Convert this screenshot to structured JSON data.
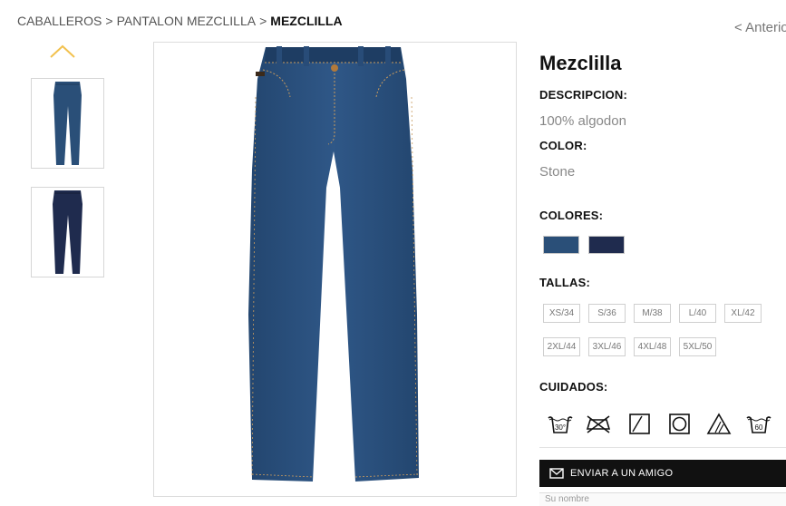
{
  "breadcrumb": {
    "items": [
      "CABALLEROS",
      "PANTALON MEZCLILLA"
    ],
    "separator": ">",
    "current": "MEZCLILLA"
  },
  "nav": {
    "previous_label": "< Anterior"
  },
  "gallery": {
    "up_arrow_icon": "chevron-up-icon",
    "thumbnails": [
      "jeans-stone-thumbnail",
      "jeans-dark-thumbnail"
    ],
    "main_image": "jeans-stone-front-photo"
  },
  "product": {
    "title": "Mezclilla",
    "description_label": "DESCRIPCION:",
    "description_value": "100% algodon",
    "color_label": "COLOR:",
    "color_value": "Stone",
    "colors_label": "COLORES:",
    "colors": [
      "#2a4f78",
      "#1f2b4e"
    ],
    "sizes_label": "TALLAS:",
    "sizes": [
      "XS/34",
      "S/36",
      "M/38",
      "L/40",
      "XL/42",
      "2XL/44",
      "3XL/46",
      "4XL/48",
      "5XL/50"
    ],
    "care_label": "CUIDADOS:",
    "care_icons": [
      "wash-30-icon",
      "no-iron-icon",
      "dry-flat-icon",
      "tumble-dry-icon",
      "bleach-icon",
      "wash-60-icon"
    ]
  },
  "share": {
    "email_icon": "envelope-icon",
    "label": "ENVIAR A UN AMIGO",
    "name_placeholder": "Su nombre"
  },
  "colors": {
    "accent_arrow": "#f2c14e",
    "bar": "#111111"
  }
}
